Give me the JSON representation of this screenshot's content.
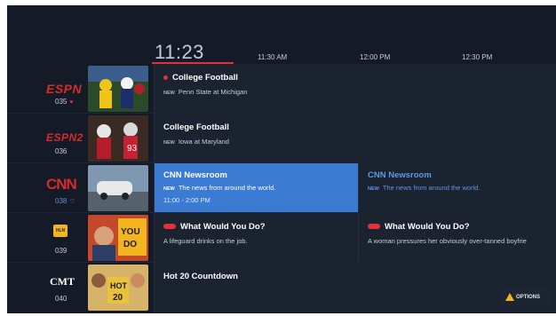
{
  "guide": {
    "clock": "11:23",
    "timeslots": [
      "11:30 AM",
      "12:00 PM",
      "12:30 PM"
    ],
    "options_label": "OPTIONS"
  },
  "channels": [
    {
      "logo": "ESPN",
      "number": "035",
      "favorite": true,
      "programs": [
        {
          "title": "College Football",
          "new": "NEW",
          "subtitle": "Penn State at Michigan",
          "live_dot": true
        }
      ]
    },
    {
      "logo": "ESPN2",
      "number": "036",
      "favorite": false,
      "programs": [
        {
          "title": "College Football",
          "new": "NEW",
          "subtitle": "Iowa at Maryland"
        }
      ]
    },
    {
      "logo": "CNN",
      "number": "038",
      "favorite": true,
      "programs": [
        {
          "title": "CNN Newsroom",
          "new": "NEW",
          "subtitle": "The news from around the world.",
          "time": "11:00 - 2:00 PM",
          "selected": true
        },
        {
          "title": "CNN Newsroom",
          "new": "NEW",
          "subtitle": "The news from around the world."
        }
      ]
    },
    {
      "logo": "HLN",
      "number": "039",
      "favorite": false,
      "programs": [
        {
          "title": "What Would You Do?",
          "subtitle": "A lifeguard drinks on the job.",
          "cc": true
        },
        {
          "title": "What Would You Do?",
          "subtitle": "A woman pressures her obviously over-tanned boyfrie",
          "cc": true
        }
      ]
    },
    {
      "logo": "CMT",
      "number": "040",
      "favorite": false,
      "programs": [
        {
          "title": "Hot 20 Countdown"
        }
      ]
    }
  ],
  "colors": {
    "accent": "#e0323b",
    "selected": "#3b7bd3",
    "background": "#141b27"
  }
}
